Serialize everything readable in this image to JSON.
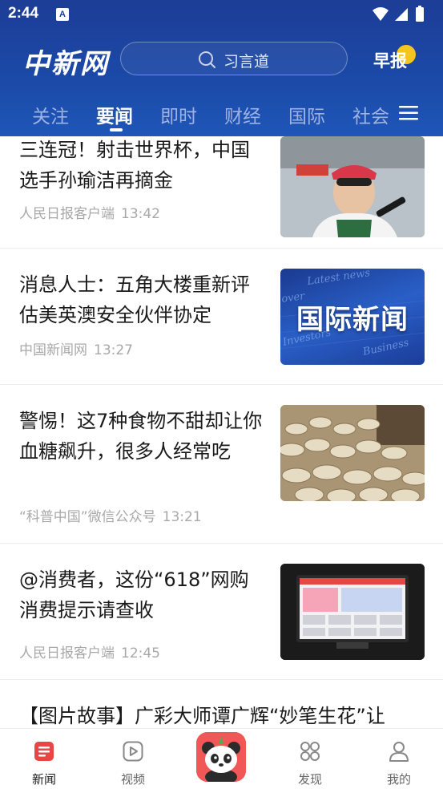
{
  "status_bar": {
    "time": "2:44",
    "notification_glyph": "A"
  },
  "header": {
    "logo": "中新网",
    "search": {
      "placeholder": "习言道"
    },
    "morning_label": "早报",
    "tabs": [
      {
        "label": "关注",
        "active": false
      },
      {
        "label": "要闻",
        "active": true
      },
      {
        "label": "即时",
        "active": false
      },
      {
        "label": "财经",
        "active": false
      },
      {
        "label": "国际",
        "active": false
      },
      {
        "label": "社会",
        "active": false
      }
    ]
  },
  "articles": [
    {
      "title": "三连冠！射击世界杯，中国选手孙瑜洁再摘金",
      "source": "人民日报客户端",
      "time": "13:42"
    },
    {
      "title": "消息人士：五角大楼重新评估美英澳安全伙伴协定",
      "source": "中国新闻网",
      "time": "13:27",
      "thumb_label": "国际新闻",
      "thumb_words": [
        "Latest news",
        "Investors",
        "Business",
        "over"
      ]
    },
    {
      "title": "警惕！这7种食物不甜却让你血糖飙升，很多人经常吃",
      "source": "“科普中国”微信公众号",
      "time": "13:21"
    },
    {
      "title": "@消费者，这份“618”网购消费提示请查收",
      "source": "人民日报客户端",
      "time": "12:45"
    },
    {
      "title": "【图片故事】广彩大师谭广辉“妙笔生花”让"
    }
  ],
  "bottom_nav": [
    {
      "label": "新闻",
      "icon": "news-icon",
      "active": true
    },
    {
      "label": "视频",
      "icon": "video-icon",
      "active": false
    },
    {
      "label": "",
      "icon": "panda-icon",
      "active": false
    },
    {
      "label": "发现",
      "icon": "discover-icon",
      "active": false
    },
    {
      "label": "我的",
      "icon": "profile-icon",
      "active": false
    }
  ],
  "colors": {
    "header_blue": "#1d3d96",
    "accent_red": "#e84545",
    "morning_dot": "#f4c51f"
  }
}
